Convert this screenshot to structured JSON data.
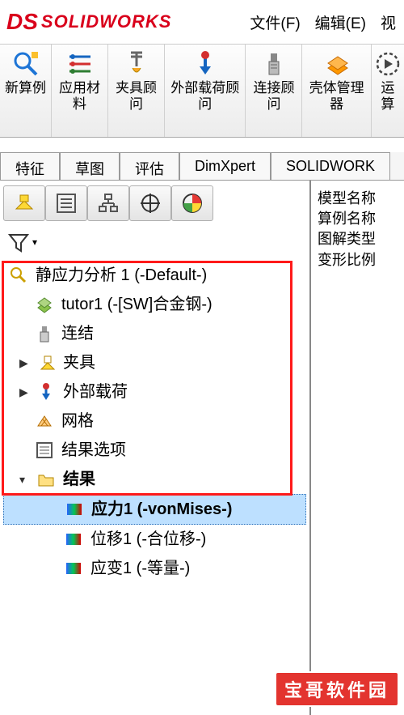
{
  "app": {
    "logo_prefix": "DS",
    "logo_text": "SOLIDWORKS"
  },
  "menu": {
    "file": "文件(F)",
    "edit": "编辑(E)",
    "view": "视"
  },
  "ribbon": {
    "new_study": "新算例",
    "apply_material": "应用材料",
    "fixture_advisor": "夹具顾问",
    "external_loads": "外部载荷顾问",
    "connection_advisor": "连接顾问",
    "shell_manager": "壳体管理器",
    "run": "运算"
  },
  "doc_tabs": [
    "特征",
    "草图",
    "评估",
    "DimXpert",
    "SOLIDWORK"
  ],
  "info": {
    "model_name_label": "模型名称",
    "study_name_label": "算例名称",
    "plot_type_label": "图解类型",
    "deform_scale_label": "变形比例"
  },
  "tree": {
    "root": "静应力分析 1 (-Default-)",
    "material": "tutor1 (-[SW]合金钢-)",
    "connections": "连结",
    "fixtures": "夹具",
    "external_loads": "外部载荷",
    "mesh": "网格",
    "result_options": "结果选项",
    "results": "结果",
    "stress": "应力1 (-vonMises-)",
    "displacement": "位移1 (-合位移-)",
    "strain": "应变1 (-等量-)"
  },
  "watermark": "宝哥软件园"
}
